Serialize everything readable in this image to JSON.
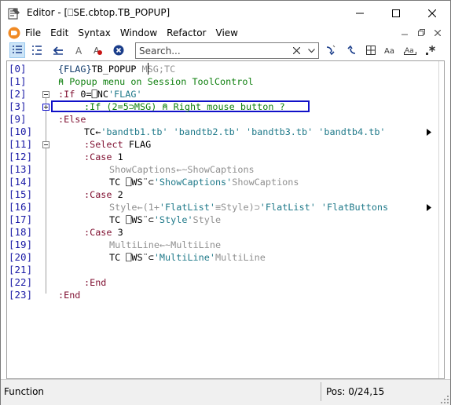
{
  "window": {
    "title": "Editor - [⎕SE.cbtop.TB_POPUP]",
    "controls": [
      "minimize-icon",
      "maximize-icon",
      "close-icon"
    ]
  },
  "menu": {
    "items": [
      "File",
      "Edit",
      "Syntax",
      "Window",
      "Refactor",
      "View"
    ]
  },
  "toolbar": {
    "buttons": [
      "line-numbers-icon",
      "outline-icon",
      "exit-icon",
      "lowercase-a-icon",
      "lock-icon",
      "close-circle-icon"
    ],
    "search_placeholder": "Search...",
    "search_value": "",
    "right_buttons": [
      "search-next-icon",
      "search-previous-icon",
      "toggle-panel-icon",
      "match-case-icon",
      "whole-word-icon",
      "regex-icon"
    ]
  },
  "editor": {
    "lines": [
      {
        "num": "[0]",
        "tokens": [
          [
            "{FLAG}",
            "c-dark"
          ],
          [
            "TB_POPUP",
            "c-name"
          ],
          [
            " MSG;TC",
            "c-gray"
          ]
        ]
      },
      {
        "num": "[1]",
        "tokens": [
          [
            "⍝ Popup menu on Session ToolControl",
            "c-grn"
          ]
        ]
      },
      {
        "num": "[2]",
        "tokens": [
          [
            ":If ",
            "c-ctrl"
          ],
          [
            "0=⎕NC",
            "c-sys"
          ],
          [
            "'FLAG'",
            "c-str"
          ]
        ]
      },
      {
        "num": "[3]",
        "tokens": [
          [
            ":If (2=5⊃MSG) ⍝ Right mouse button ?",
            "c-grn"
          ]
        ]
      },
      {
        "num": "[9]",
        "tokens": [
          [
            ":Else",
            "c-ctrl"
          ]
        ]
      },
      {
        "num": "[10]",
        "tokens": [
          [
            "TC←",
            "c-name"
          ],
          [
            "'bandtb1.tb' 'bandtb2.tb' 'bandtb3.tb' 'bandtb4.tb'",
            "c-str"
          ]
        ]
      },
      {
        "num": "[11]",
        "tokens": [
          [
            ":Select ",
            "c-ctrl"
          ],
          [
            "FLAG",
            "c-name"
          ]
        ]
      },
      {
        "num": "[12]",
        "tokens": [
          [
            ":Case ",
            "c-ctrl"
          ],
          [
            "1",
            "c-name"
          ]
        ]
      },
      {
        "num": "[13]",
        "tokens": [
          [
            "ShowCaptions←~ShowCaptions",
            "c-gray"
          ]
        ]
      },
      {
        "num": "[14]",
        "tokens": [
          [
            "TC ⎕WS¨⊂",
            "c-name"
          ],
          [
            "'ShowCaptions'",
            "c-str"
          ],
          [
            "ShowCaptions",
            "c-gray"
          ]
        ]
      },
      {
        "num": "[15]",
        "tokens": [
          [
            ":Case ",
            "c-ctrl"
          ],
          [
            "2",
            "c-name"
          ]
        ]
      },
      {
        "num": "[16]",
        "tokens": [
          [
            "Style←(1+",
            "c-gray"
          ],
          [
            "'FlatList'",
            "c-str"
          ],
          [
            "≡Style)⊃",
            "c-gray"
          ],
          [
            "'FlatList' 'FlatButtons",
            "c-str"
          ]
        ]
      },
      {
        "num": "[17]",
        "tokens": [
          [
            "TC ⎕WS¨⊂",
            "c-name"
          ],
          [
            "'Style'",
            "c-str"
          ],
          [
            "Style",
            "c-gray"
          ]
        ]
      },
      {
        "num": "[18]",
        "tokens": [
          [
            ":Case ",
            "c-ctrl"
          ],
          [
            "3",
            "c-name"
          ]
        ]
      },
      {
        "num": "[19]",
        "tokens": [
          [
            "MultiLine←~MultiLine",
            "c-gray"
          ]
        ]
      },
      {
        "num": "[20]",
        "tokens": [
          [
            "TC ⎕WS¨⊂",
            "c-name"
          ],
          [
            "'MultiLine'",
            "c-str"
          ],
          [
            "MultiLine",
            "c-gray"
          ]
        ]
      },
      {
        "num": "[21]",
        "tokens": []
      },
      {
        "num": "[22]",
        "tokens": [
          [
            ":End",
            "c-ctrl"
          ]
        ]
      },
      {
        "num": "[23]",
        "tokens": [
          [
            ":End",
            "c-ctrl"
          ]
        ]
      }
    ]
  },
  "status": {
    "left": "Function",
    "right": "Pos: 0/24,15"
  }
}
